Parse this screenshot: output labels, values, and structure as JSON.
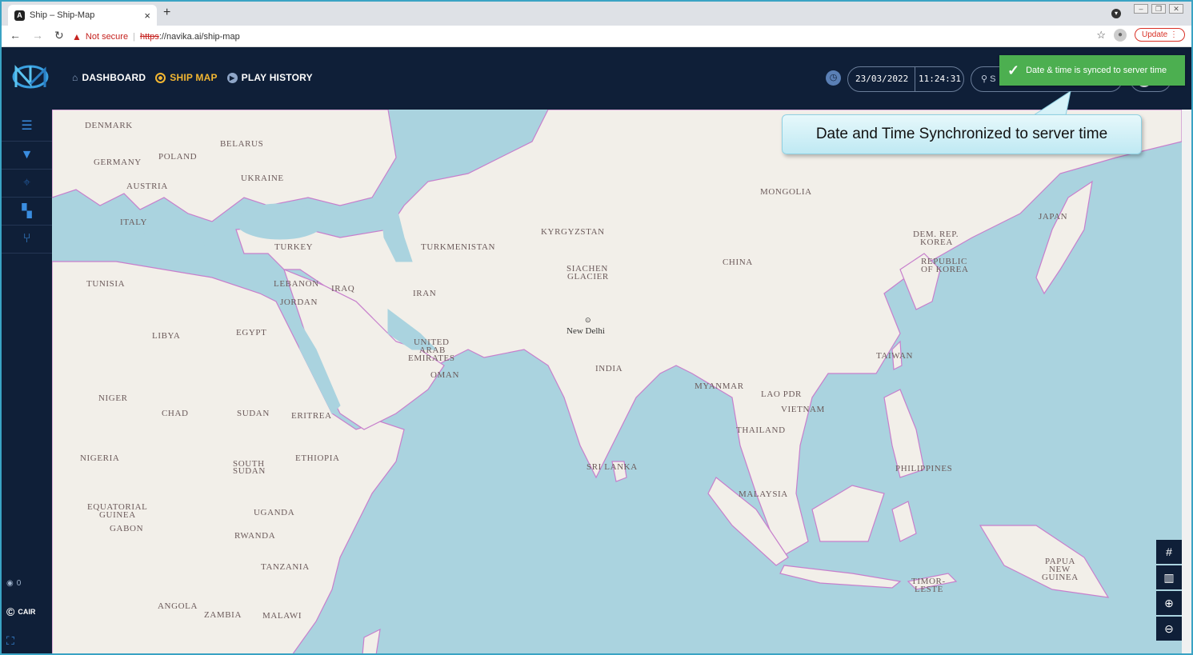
{
  "browser": {
    "tab_title": "Ship – Ship-Map",
    "favicon": "A",
    "close": "×",
    "new_tab": "+",
    "security_warning": "Not secure",
    "url_scheme": "https",
    "url_rest": "://navika.ai/ship-map",
    "update_label": "Update"
  },
  "header": {
    "nav": [
      {
        "label": "DASHBOARD",
        "icon": "home-icon"
      },
      {
        "label": "SHIP MAP",
        "icon": "target-icon"
      },
      {
        "label": "PLAY HISTORY",
        "icon": "play-icon"
      }
    ],
    "date": "23/03/2022",
    "time": "11:24:31",
    "search_prefix": "S"
  },
  "toast": {
    "message": "Date & time is synced to server time",
    "color": "#4caf50"
  },
  "callout": {
    "text": "Date and Time Synchronized to server time"
  },
  "sidebar": {
    "count": "0",
    "brand": "CAIR"
  },
  "map": {
    "labels": {
      "denmark": "DENMARK",
      "belarus": "BELARUS",
      "poland": "POLAND",
      "germany": "GERMANY",
      "ukraine": "UKRAINE",
      "austria": "AUSTRIA",
      "italy": "ITALY",
      "turkey": "TURKEY",
      "tunisia": "TUNISIA",
      "lebanon": "LEBANON",
      "iraq": "IRAQ",
      "jordan": "JORDAN",
      "libya": "LIBYA",
      "egypt": "EGYPT",
      "iran": "IRAN",
      "turkmenistan": "TURKMENISTAN",
      "kyrgyzstan": "KYRGYZSTAN",
      "siachen": "SIACHEN",
      "glacier": "GLACIER",
      "mongolia": "MONGOLIA",
      "china": "CHINA",
      "japan": "JAPAN",
      "dem_rep": "DEM. REP.",
      "korea1": "KOREA",
      "republic": "REPUBLIC",
      "of_korea": "OF KOREA",
      "uae1": "UNITED",
      "uae2": "ARAB",
      "uae3": "EMIRATES",
      "oman": "OMAN",
      "india": "INDIA",
      "taiwan": "TAIWAN",
      "myanmar": "MYANMAR",
      "lao": "LAO PDR",
      "vietnam": "VIETNAM",
      "thailand": "THAILAND",
      "niger": "NIGER",
      "chad": "CHAD",
      "sudan": "SUDAN",
      "eritrea": "ERITREA",
      "nigeria": "NIGERIA",
      "south": "SOUTH",
      "sudan2": "SUDAN",
      "ethiopia": "ETHIOPIA",
      "srilanka": "SRI LANKA",
      "philippines": "PHILIPPINES",
      "malaysia": "MALAYSIA",
      "eq1": "EQUATORIAL",
      "eq2": "GUINEA",
      "gabon": "GABON",
      "uganda": "UGANDA",
      "rwanda": "RWANDA",
      "tanzania": "TANZANIA",
      "angola": "ANGOLA",
      "zambia": "ZAMBIA",
      "malawi": "MALAWI",
      "png1": "PAPUA",
      "png2": "NEW",
      "png3": "GUINEA",
      "timor1": "TIMOR-",
      "timor2": "LESTE",
      "new_delhi": "New Delhi"
    },
    "colors": {
      "water": "#aad3df",
      "land": "#f2efe9",
      "border": "#c77fcc"
    }
  }
}
